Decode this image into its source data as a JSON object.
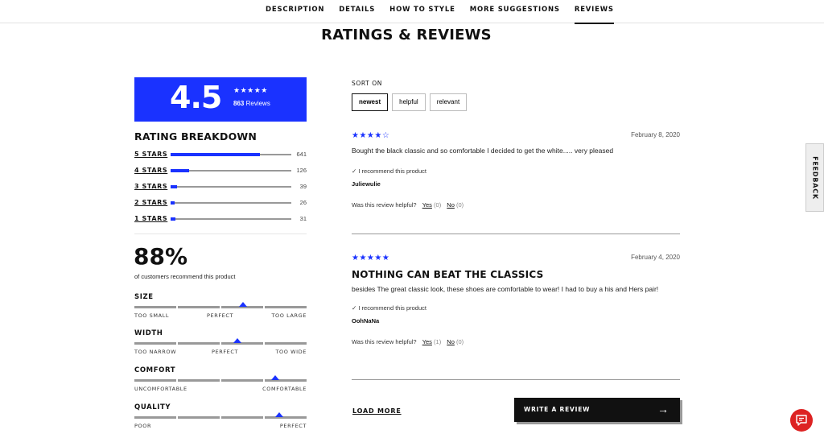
{
  "nav": {
    "tabs": [
      {
        "label": "DESCRIPTION"
      },
      {
        "label": "DETAILS"
      },
      {
        "label": "HOW TO STYLE"
      },
      {
        "label": "MORE SUGGESTIONS"
      },
      {
        "label": "REVIEWS",
        "active": true
      }
    ]
  },
  "page_title": "RATINGS & REVIEWS",
  "summary": {
    "average": "4.5",
    "stars": "★★★★★",
    "count": "863",
    "count_suffix": "Reviews",
    "accent": "#1a32ff"
  },
  "breakdown": {
    "title": "RATING BREAKDOWN",
    "rows": [
      {
        "label": "5 STARS",
        "count": "641",
        "fraction": 0.74
      },
      {
        "label": "4 STARS",
        "count": "126",
        "fraction": 0.15
      },
      {
        "label": "3 STARS",
        "count": "39",
        "fraction": 0.05
      },
      {
        "label": "2 STARS",
        "count": "26",
        "fraction": 0.03
      },
      {
        "label": "1 STARS",
        "count": "31",
        "fraction": 0.04
      }
    ]
  },
  "recommend": {
    "percent": "88%",
    "caption": "of customers recommend this product"
  },
  "fit": [
    {
      "title": "SIZE",
      "left": "TOO SMALL",
      "middle": "PERFECT",
      "right": "TOO LARGE",
      "position": 0.63
    },
    {
      "title": "WIDTH",
      "left": "TOO NARROW",
      "middle": "PERFECT",
      "right": "TOO WIDE",
      "position": 0.6
    },
    {
      "title": "COMFORT",
      "left": "UNCOMFORTABLE",
      "middle": "",
      "right": "COMFORTABLE",
      "position": 0.82
    },
    {
      "title": "QUALITY",
      "left": "POOR",
      "middle": "",
      "right": "PERFECT",
      "position": 0.84
    }
  ],
  "sort": {
    "label": "SORT ON",
    "options": [
      {
        "label": "newest",
        "active": true
      },
      {
        "label": "helpful"
      },
      {
        "label": "relevant"
      }
    ]
  },
  "reviews": [
    {
      "stars": "★★★★☆",
      "date": "February 8, 2020",
      "title": "",
      "body": "Bought the black classic and so comfortable I decided to get the white..... very pleased",
      "recommend": "✓ I recommend this product",
      "author": "Juliewulie",
      "helpful_prompt": "Was this review helpful?",
      "yes": "Yes",
      "yes_count": "(0)",
      "no": "No",
      "no_count": "(0)"
    },
    {
      "stars": "★★★★★",
      "date": "February 4, 2020",
      "title": "NOTHING CAN BEAT THE CLASSICS",
      "body": "besides The great classic look, these shoes are comfortable to wear! I had to buy a his and Hers pair!",
      "recommend": "✓ I recommend this product",
      "author": "OohNaNa",
      "helpful_prompt": "Was this review helpful?",
      "yes": "Yes",
      "yes_count": "(1)",
      "no": "No",
      "no_count": "(0)"
    }
  ],
  "load_more": "LOAD MORE",
  "write_review": {
    "label": "WRITE A REVIEW",
    "arrow": "→"
  },
  "feedback": "FEEDBACK",
  "chat": {
    "icon": "chat-icon",
    "color": "#dd2222"
  }
}
